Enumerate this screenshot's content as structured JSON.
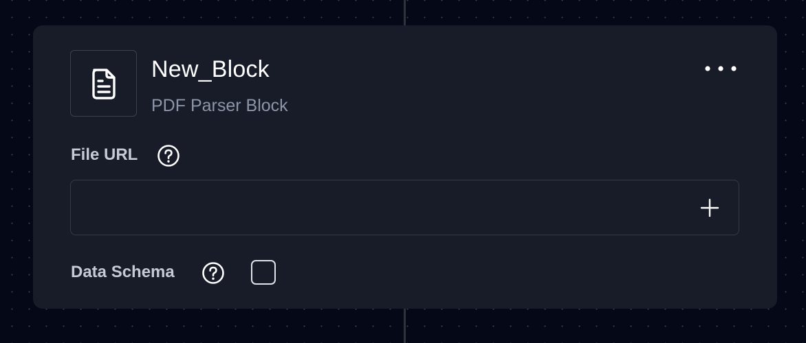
{
  "block": {
    "title": "New_Block",
    "subtitle": "PDF Parser Block",
    "icon": "document-icon",
    "menu_icon": "more-horizontal-icon"
  },
  "fields": {
    "file_url": {
      "label": "File URL",
      "help_icon": "question-circle-icon",
      "value": "",
      "add_icon": "plus-icon"
    },
    "data_schema": {
      "label": "Data Schema",
      "help_icon": "question-circle-icon",
      "checked": false
    }
  },
  "colors": {
    "canvas_background": "#050816",
    "card_background": "#181c28",
    "title_text": "#ffffff",
    "subtitle_text": "#8d96a8",
    "label_text": "#c5cad4",
    "border": "#343a47"
  }
}
